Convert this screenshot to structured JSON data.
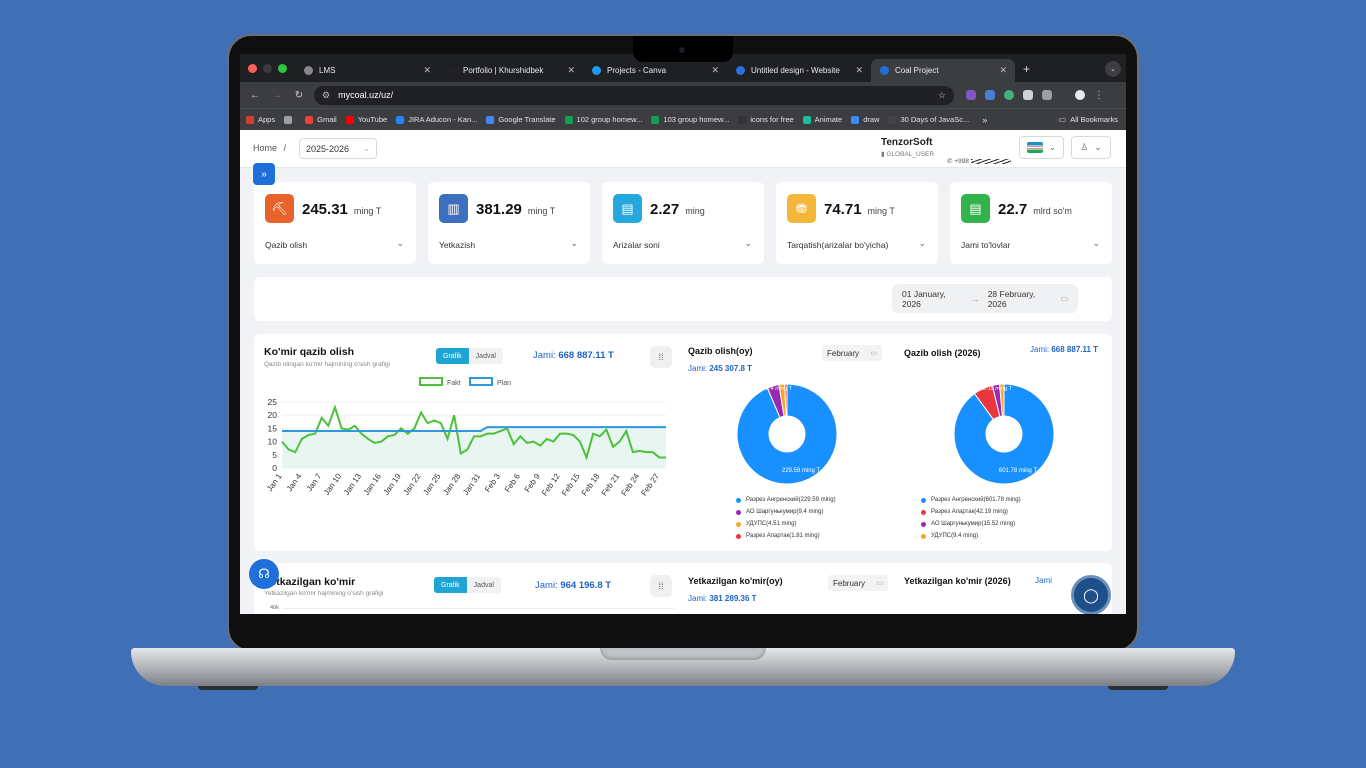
{
  "browser": {
    "tabs": [
      {
        "label": "LMS",
        "color": "#888888"
      },
      {
        "label": "Portfolio | Khurshidbek",
        "color": "#222222"
      },
      {
        "label": "Projects - Canva",
        "color": "#1d9bf0"
      },
      {
        "label": "Untitled design - Website",
        "color": "#2b6de0"
      },
      {
        "label": "Coal Project",
        "color": "#1e6fd9"
      }
    ],
    "url": "mycoal.uz/uz/",
    "bookmarks": [
      {
        "label": "Apps",
        "color": "#d23f31"
      },
      {
        "label": "",
        "color": "#9aa0a6"
      },
      {
        "label": "Gmail",
        "color": "#ea4335"
      },
      {
        "label": "YouTube",
        "color": "#ff0000"
      },
      {
        "label": "JIRA Aducon - Kan...",
        "color": "#2684ff"
      },
      {
        "label": "Google Translate",
        "color": "#4285f4"
      },
      {
        "label": "102 group homew...",
        "color": "#0f9d58"
      },
      {
        "label": "103 group homew...",
        "color": "#0f9d58"
      },
      {
        "label": "icons for free",
        "color": "#333333"
      },
      {
        "label": "Animate",
        "color": "#1abc9c"
      },
      {
        "label": "draw",
        "color": "#3d8af7"
      },
      {
        "label": "30 Days of JavaSc...",
        "color": "#444444"
      }
    ],
    "more_bookmarks": "»",
    "all_bookmarks": "All Bookmarks"
  },
  "header": {
    "home": "Home",
    "separator": "/",
    "year": "2025-2026",
    "company": "TenzorSoft",
    "role": "GLOBAL_USER",
    "phone": "+998"
  },
  "kpis": [
    {
      "value": "245.31",
      "unit": "ming T",
      "label": "Qazib olish",
      "color": "#e8622c",
      "icon": "⛏"
    },
    {
      "value": "381.29",
      "unit": "ming T",
      "label": "Yetkazish",
      "color": "#3d6fbf",
      "icon": "▥"
    },
    {
      "value": "2.27",
      "unit": "ming",
      "label": "Arizalar soni",
      "color": "#26a7de",
      "icon": "▤"
    },
    {
      "value": "74.71",
      "unit": "ming T",
      "label": "Tarqatish(arizalar bo'yicha)",
      "color": "#f4b73a",
      "icon": "⛃"
    },
    {
      "value": "22.7",
      "unit": "mlrd so'm",
      "label": "Jami to'lovlar",
      "color": "#33b44a",
      "icon": "▤"
    }
  ],
  "date_range": {
    "start": "01 January, 2026",
    "end": "28 February, 2026"
  },
  "card1": {
    "title": "Ko'mir qazib olish",
    "subtitle": "Qazib olingan ko'mir hajmining o'sish grafigi",
    "toggle": [
      "Grafik",
      "Jadval"
    ],
    "total_label": "Jami:",
    "total_value": "668 887.11 T",
    "monthly": {
      "title": "Qazib olish(oy)",
      "month": "February",
      "total_label": "Jami:",
      "total_value": "245 307.8 T"
    },
    "yearly": {
      "title": "Qazib olish (2026)",
      "total_label": "Jami:",
      "total_value": "668 887.11 T"
    }
  },
  "card2": {
    "title": "Yetkazilgan ko'mir",
    "subtitle": "Yetkazilgan ko'mir hajmining o'sish grafigi",
    "toggle": [
      "Grafik",
      "Jadval"
    ],
    "total_label": "Jami:",
    "total_value": "964 196.8 T",
    "ytick": "40k",
    "monthly": {
      "title": "Yetkazilgan ko'mir(oy)",
      "month": "February",
      "total_label": "Jami:",
      "total_value": "381 289.36 T"
    },
    "yearly": {
      "title": "Yetkazilgan ko'mir (2026)",
      "total_label": "Jami"
    }
  },
  "chart_data": [
    {
      "type": "line",
      "title": "Ko'mir qazib olish",
      "x": [
        "Jan 1",
        "Jan 2",
        "Jan 3",
        "Jan 4",
        "Jan 5",
        "Jan 6",
        "Jan 7",
        "Jan 8",
        "Jan 9",
        "Jan 10",
        "Jan 11",
        "Jan 12",
        "Jan 13",
        "Jan 14",
        "Jan 15",
        "Jan 16",
        "Jan 17",
        "Jan 18",
        "Jan 19",
        "Jan 20",
        "Jan 21",
        "Jan 22",
        "Jan 23",
        "Jan 24",
        "Jan 25",
        "Jan 26",
        "Jan 27",
        "Jan 28",
        "Jan 29",
        "Jan 30",
        "Jan 31",
        "Feb 1",
        "Feb 2",
        "Feb 3",
        "Feb 4",
        "Feb 5",
        "Feb 6",
        "Feb 7",
        "Feb 8",
        "Feb 9",
        "Feb 10",
        "Feb 11",
        "Feb 12",
        "Feb 13",
        "Feb 14",
        "Feb 15",
        "Feb 16",
        "Feb 17",
        "Feb 18",
        "Feb 19",
        "Feb 20",
        "Feb 21",
        "Feb 22",
        "Feb 23",
        "Feb 24",
        "Feb 25",
        "Feb 26",
        "Feb 27",
        "Feb 28"
      ],
      "xticks": [
        "Jan 1",
        "Jan 4",
        "Jan 7",
        "Jan 10",
        "Jan 13",
        "Jan 16",
        "Jan 19",
        "Jan 22",
        "Jan 25",
        "Jan 28",
        "Jan 31",
        "Feb 3",
        "Feb 6",
        "Feb 9",
        "Feb 12",
        "Feb 15",
        "Feb 18",
        "Feb 21",
        "Feb 24",
        "Feb 27"
      ],
      "yticks": [
        0,
        5,
        10,
        15,
        20,
        25
      ],
      "ylim": [
        0,
        25
      ],
      "series": [
        {
          "name": "Fakt",
          "color": "#4cc23a",
          "values": [
            10,
            7,
            6,
            11,
            12.5,
            13,
            19,
            16,
            23,
            15,
            14.5,
            16,
            13,
            11,
            9.5,
            10,
            12,
            12.5,
            15,
            13,
            15,
            21,
            17,
            18,
            17,
            11,
            20,
            5.5,
            7,
            12,
            12,
            13,
            13,
            14,
            15,
            9,
            12,
            9.5,
            10,
            8.5,
            11,
            10,
            13,
            13,
            12.5,
            10,
            4,
            13,
            12,
            14.5,
            8,
            10,
            14,
            6,
            6.5,
            6,
            6,
            4,
            4
          ]
        },
        {
          "name": "Plan",
          "color": "#2a9ae0",
          "values": [
            14,
            14,
            14,
            14,
            14,
            14,
            14,
            14,
            14,
            14,
            14,
            14,
            14,
            14,
            14,
            14,
            14,
            14,
            14,
            14,
            14,
            14,
            14,
            14,
            14,
            14,
            14,
            14,
            14,
            14,
            14,
            15.5,
            15.5,
            15.5,
            15.5,
            15.5,
            15.5,
            15.5,
            15.5,
            15.5,
            15.5,
            15.5,
            15.5,
            15.5,
            15.5,
            15.5,
            15.5,
            15.5,
            15.5,
            15.5,
            15.5,
            15.5,
            15.5,
            15.5,
            15.5,
            15.5,
            15.5,
            15.5,
            15.5
          ]
        }
      ]
    },
    {
      "type": "pie",
      "title": "Qazib olish(oy)",
      "labels": [
        "Разрез Ангренский(229.59 ming)",
        "АО Шаргунькумир(9.4 ming)",
        "УДУПС(4.51 ming)",
        "Разрез Апартак(1.81 ming)"
      ],
      "values": [
        229.59,
        9.4,
        4.51,
        1.81
      ],
      "colors": [
        "#1890ff",
        "#9c27b0",
        "#f5a623",
        "#e8383d"
      ],
      "data_labels": [
        "229.59 ming T",
        "9.4 ming T"
      ]
    },
    {
      "type": "pie",
      "title": "Qazib olish (2026)",
      "labels": [
        "Разрез Ангренский(601.78 ming)",
        "Разрез Апартак(42.19 ming)",
        "АО Шаргунькумир(15.52 ming)",
        "УДУПС(9.4 ming)"
      ],
      "values": [
        601.78,
        42.19,
        15.52,
        9.4
      ],
      "colors": [
        "#1890ff",
        "#e8383d",
        "#9c27b0",
        "#f5a623"
      ],
      "data_labels": [
        "601.78 ming T",
        "42.19 ming T"
      ]
    }
  ]
}
